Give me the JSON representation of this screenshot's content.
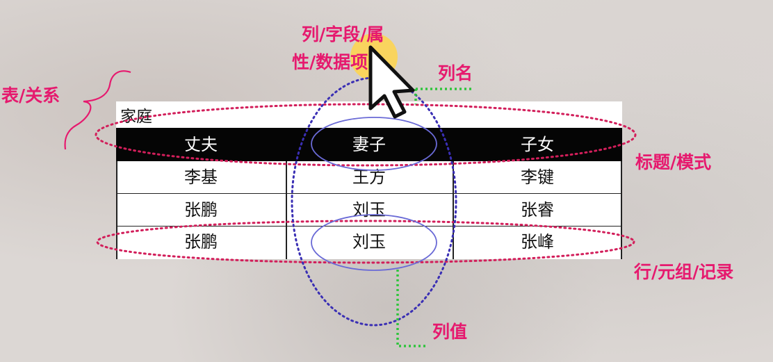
{
  "labels": {
    "table_relation": "表/关系",
    "column_field": "列/字段/属",
    "column_field_2": "性/数据项",
    "column_name": "列名",
    "header_schema": "标题/模式",
    "row_tuple": "行/元组/记录",
    "column_value": "列值"
  },
  "table": {
    "title": "家庭",
    "headers": [
      "丈夫",
      "妻子",
      "子女"
    ],
    "rows": [
      [
        "李基",
        "王方",
        "李键"
      ],
      [
        "张鹏",
        "刘玉",
        "张睿"
      ],
      [
        "张鹏",
        "刘玉",
        "张峰"
      ]
    ]
  },
  "colors": {
    "annotation": "#e6196e",
    "dotted_red": "#d21e5a",
    "dotted_blue": "#3a2fb4",
    "ellipse_blue": "#6a6ad6",
    "dotted_green": "#2fc43c",
    "highlight": "#ffd54a"
  },
  "icons": {
    "cursor": "mouse-pointer-icon"
  }
}
